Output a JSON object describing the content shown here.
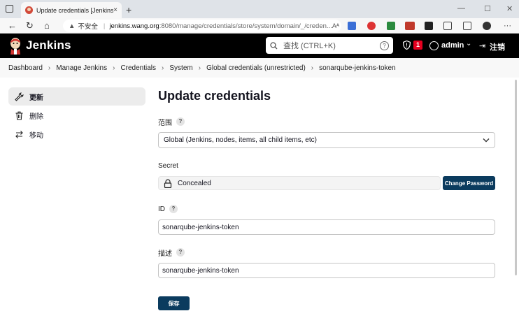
{
  "browser": {
    "tab_title": "Update credentials [Jenkins]",
    "tab_close": "×",
    "new_tab": "+",
    "url_insecure": "不安全",
    "url_host": "jenkins.wang.org",
    "url_path": ":8080/manage/credentials/store/system/domain/_/creden...",
    "url_readmode": "Aᴬ",
    "min": "—",
    "max": "☐",
    "close": "✕"
  },
  "header": {
    "title": "Jenkins",
    "search_placeholder": "查找 (CTRL+K)",
    "search_help": "?",
    "alert_count": "1",
    "user": "admin",
    "logout": "注销"
  },
  "breadcrumb": [
    "Dashboard",
    "Manage Jenkins",
    "Credentials",
    "System",
    "Global credentials (unrestricted)",
    "sonarqube-jenkins-token"
  ],
  "sidebar": {
    "items": [
      {
        "label": "更新",
        "icon": "wrench-icon"
      },
      {
        "label": "删除",
        "icon": "trash-icon"
      },
      {
        "label": "移动",
        "icon": "move-icon"
      }
    ]
  },
  "form": {
    "title": "Update credentials",
    "scope_label": "范围",
    "scope_value": "Global (Jenkins, nodes, items, all child items, etc)",
    "secret_label": "Secret",
    "secret_value": "Concealed",
    "change_password": "Change Password",
    "id_label": "ID",
    "id_value": "sonarqube-jenkins-token",
    "desc_label": "描述",
    "desc_value": "sonarqube-jenkins-token",
    "save": "保存",
    "help": "?"
  },
  "colors": {
    "header_bg": "#000000",
    "button_bg": "#0b3b5e",
    "badge": "#e6001f"
  }
}
